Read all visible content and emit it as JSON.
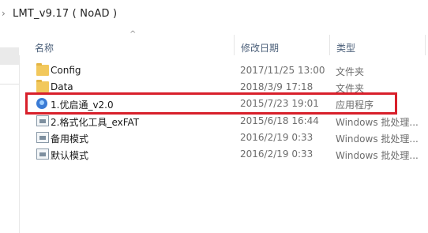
{
  "address": {
    "path": "LMT_v9.17 ( NoAD )"
  },
  "columns": {
    "name": "名称",
    "modified": "修改日期",
    "type": "类型"
  },
  "files": [
    {
      "name": "Config",
      "modified": "2017/11/25 13:00",
      "type": "文件夹",
      "icon": "folder-icon"
    },
    {
      "name": "Data",
      "modified": "2018/3/9 17:18",
      "type": "文件夹",
      "icon": "folder-icon"
    },
    {
      "name": "1.优启通_v2.0",
      "modified": "2015/7/23 19:01",
      "type": "应用程序",
      "icon": "app-icon"
    },
    {
      "name": "2.格式化工具_exFAT",
      "modified": "2015/6/18 16:44",
      "type": "Windows 批处理...",
      "icon": "batch-file-icon"
    },
    {
      "name": "备用模式",
      "modified": "2016/2/19 0:33",
      "type": "Windows 批处理...",
      "icon": "batch-file-icon"
    },
    {
      "name": "默认模式",
      "modified": "2016/2/19 0:33",
      "type": "Windows 批处理...",
      "icon": "batch-file-icon"
    }
  ],
  "colors": {
    "highlight_border": "#d81f2a",
    "header_text": "#4c607a",
    "folder": "#f2c85c"
  }
}
